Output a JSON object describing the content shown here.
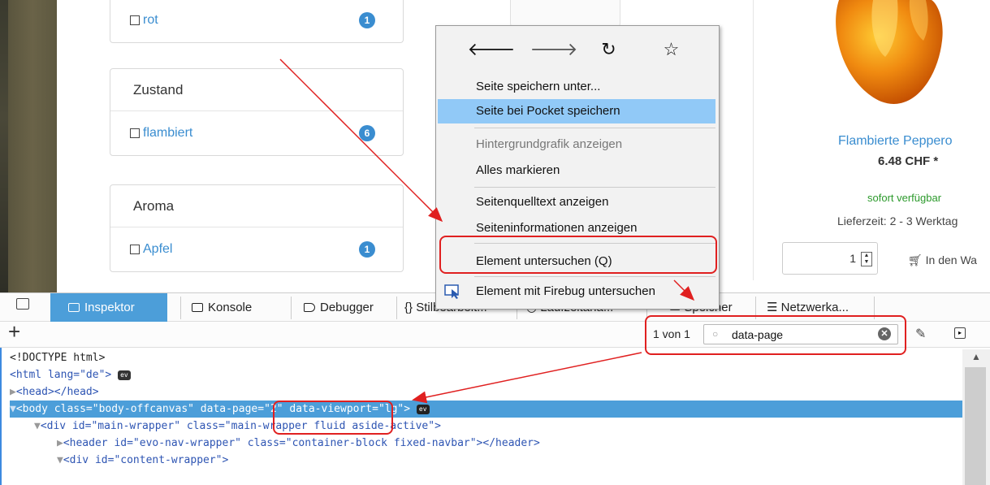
{
  "filters": [
    {
      "head": "",
      "option": "rot",
      "count": "1"
    },
    {
      "head": "Zustand",
      "option": "flambiert",
      "count": "6"
    },
    {
      "head": "Aroma",
      "option": "Apfel",
      "count": "1"
    }
  ],
  "product": {
    "name": "Flambierte Peppero",
    "price": "6.48 CHF *",
    "availability": "sofort verfügbar",
    "delivery": "Lieferzeit: 2 - 3 Werktag",
    "quantity": "1",
    "cart_label": "In den Wa"
  },
  "context_menu": {
    "nav_icons": [
      "back-arrow-icon",
      "forward-arrow-icon",
      "reload-icon",
      "bookmark-star-icon"
    ],
    "items": [
      {
        "label": "Seite speichern unter...",
        "state": "normal"
      },
      {
        "label": "Seite bei Pocket speichern",
        "state": "highlighted"
      },
      {
        "label": "Hintergrundgrafik anzeigen",
        "state": "disabled"
      },
      {
        "label": "Alles markieren",
        "state": "normal"
      },
      {
        "label": "Seitenquelltext anzeigen",
        "state": "normal"
      },
      {
        "label": "Seiteninformationen anzeigen",
        "state": "normal"
      },
      {
        "label": "Element untersuchen (Q)",
        "state": "normal"
      },
      {
        "label": "Element mit Firebug untersuchen",
        "state": "normal"
      }
    ]
  },
  "devtools": {
    "tabs": [
      "Inspektor",
      "Konsole",
      "Debugger",
      "Stilbearbeit...",
      "Laufzeitana...",
      "Speicher",
      "Netzwerka..."
    ],
    "active_tab": "Inspektor",
    "search": {
      "count": "1 von 1",
      "value": "data-page"
    },
    "tree": [
      {
        "text": "<!DOCTYPE html>"
      },
      {
        "text": "<html lang=\"de\">"
      },
      {
        "text": "<head></head>"
      },
      {
        "text": "<body class=\"body-offcanvas\" data-page=\"2\" data-viewport=\"lg\">"
      },
      {
        "text": "<div id=\"main-wrapper\" class=\"main-wrapper fluid aside-active\">"
      },
      {
        "text": "<header id=\"evo-nav-wrapper\" class=\"container-block fixed-navbar\"></header>"
      },
      {
        "text": "<div id=\"content-wrapper\">"
      }
    ],
    "ev_badge": "ev"
  },
  "colors": {
    "accent": "#4c9ed9",
    "link": "#3a8dd0",
    "annotation": "#e02020",
    "available": "#2c9a2c"
  }
}
